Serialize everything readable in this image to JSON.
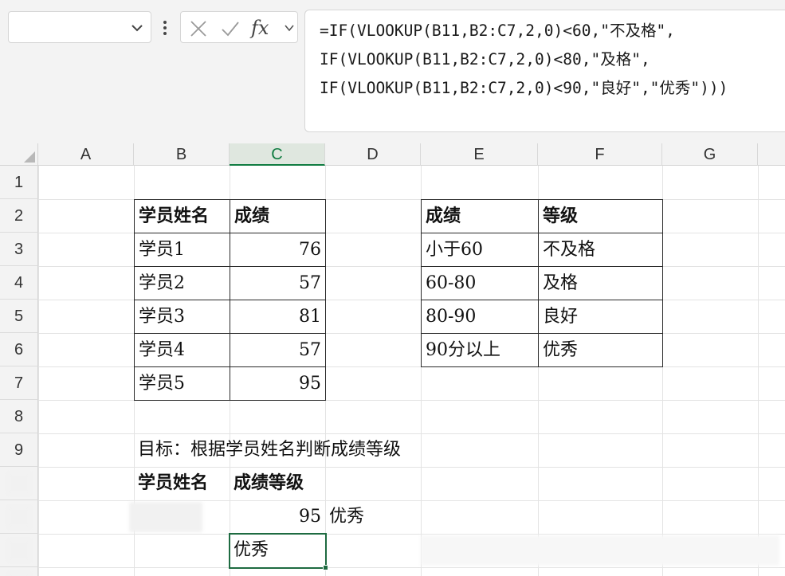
{
  "formula_bar": {
    "fx_label": "fx",
    "formula_lines": [
      "=IF(VLOOKUP(B11,B2:C7,2,0)<60,\"不及格\",",
      "IF(VLOOKUP(B11,B2:C7,2,0)<80,\"及格\",",
      "IF(VLOOKUP(B11,B2:C7,2,0)<90,\"良好\",\"优秀\")))"
    ]
  },
  "columns": [
    "A",
    "B",
    "C",
    "D",
    "E",
    "F",
    "G"
  ],
  "selected_column": "C",
  "rows": [
    "1",
    "2",
    "3",
    "4",
    "5",
    "6",
    "7",
    "8",
    "9"
  ],
  "student_table": {
    "headers": [
      "学员姓名",
      "成绩"
    ],
    "rows": [
      [
        "学员1",
        "76"
      ],
      [
        "学员2",
        "57"
      ],
      [
        "学员3",
        "81"
      ],
      [
        "学员4",
        "57"
      ],
      [
        "学员5",
        "95"
      ]
    ]
  },
  "grade_table": {
    "headers": [
      "成绩",
      "等级"
    ],
    "rows": [
      [
        "小于60",
        "不及格"
      ],
      [
        "60-80",
        "及格"
      ],
      [
        "80-90",
        "良好"
      ],
      [
        "90分以上",
        "优秀"
      ]
    ]
  },
  "goal_text": "目标：根据学员姓名判断成绩等级",
  "query": {
    "headers": [
      "学员姓名",
      "成绩等级"
    ],
    "score": "95",
    "score_grade": "优秀",
    "result": "优秀"
  },
  "colors": {
    "accent": "#107c41",
    "active_border": "#1e6b41"
  }
}
